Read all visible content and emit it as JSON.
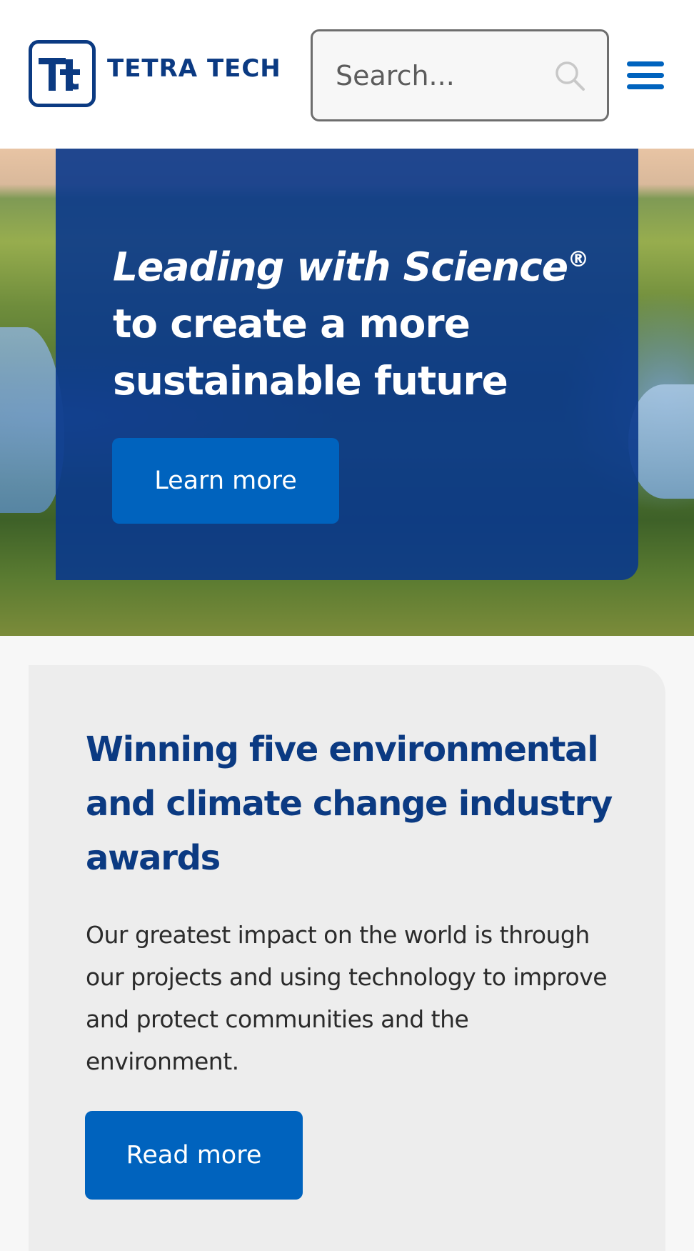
{
  "header": {
    "logo_text": "TETRA TECH",
    "search": {
      "placeholder": "Search..."
    },
    "menu_icon": "hamburger-menu-icon"
  },
  "hero": {
    "title_italic": "Leading with Science",
    "title_mark": "®",
    "title_rest": "to create a more sustainable future",
    "button_label": "Learn more",
    "background_image": "aerial view of wetland river landscape at sunset"
  },
  "awards": {
    "title": "Winning five environmental and climate change industry awards",
    "body": "Our greatest impact on the world is through our projects and using technology to improve and protect communities and the environment.",
    "button_label": "Read more"
  },
  "colors": {
    "brand_navy": "#0b3a82",
    "button_blue": "#0063be",
    "card_gray": "#ededed"
  }
}
